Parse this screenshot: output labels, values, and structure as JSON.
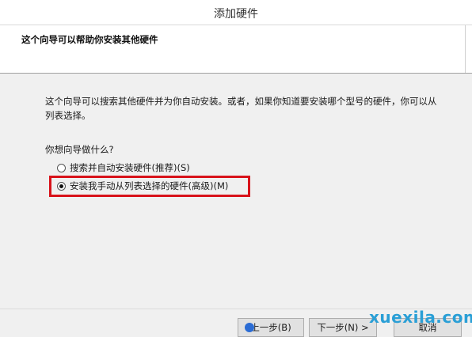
{
  "window": {
    "title": "添加硬件"
  },
  "header": {
    "heading": "这个向导可以帮助你安装其他硬件"
  },
  "content": {
    "description": "这个向导可以搜索其他硬件并为你自动安装。或者，如果你知道要安装哪个型号的硬件，你可以从列表选择。",
    "question": "你想向导做什么?",
    "options": [
      {
        "label": "搜索并自动安装硬件(推荐)(S)",
        "selected": false
      },
      {
        "label": "安装我手动从列表选择的硬件(高级)(M)",
        "selected": true
      }
    ]
  },
  "footer": {
    "back_label": "上一步(B)",
    "next_label": "下一步(N) >",
    "cancel_label": "取消"
  },
  "watermark": {
    "text": "xuexila.com"
  },
  "colors": {
    "highlight_border": "#d8121a",
    "watermark": "#2a9fd6",
    "back_icon": "#2b6cd4"
  }
}
